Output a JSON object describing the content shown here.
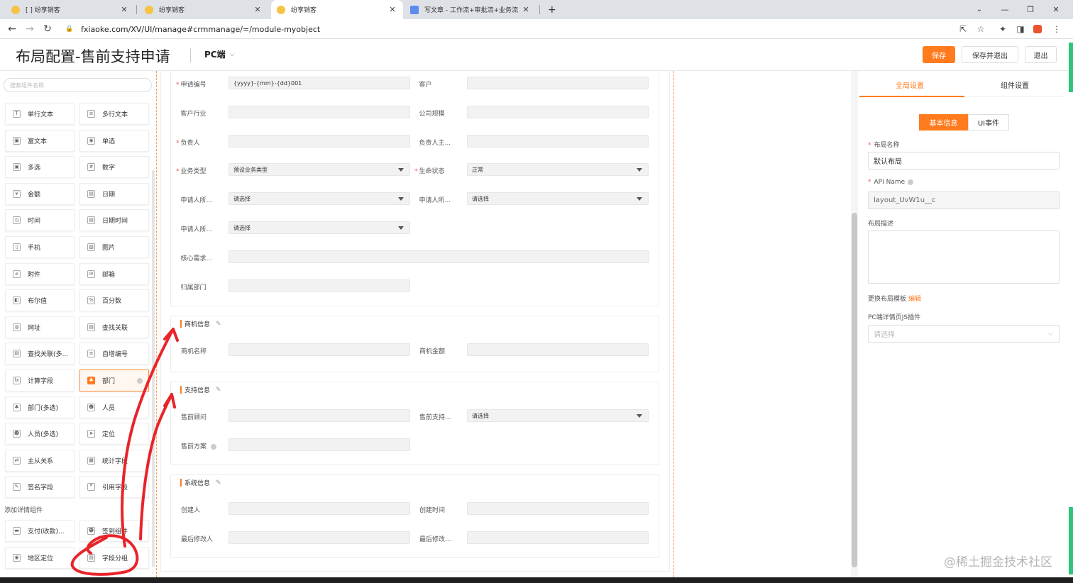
{
  "browser": {
    "tabs": [
      {
        "label": "[        ] 纷享销客",
        "active": false
      },
      {
        "label": "纷享销客",
        "active": false
      },
      {
        "label": "纷享销客",
        "active": true
      },
      {
        "label": "写文章 - 工作流+审批流+业务流",
        "active": false
      }
    ],
    "new_tab": "+",
    "url": "fxiaoke.com/XV/UI/manage#crmmanage/=/module-myobject"
  },
  "header": {
    "title": "布局配置-售前支持申请",
    "platform": "PC端",
    "save_label": "保存",
    "save_exit_label": "保存并退出",
    "exit_label": "退出"
  },
  "palette": {
    "search_placeholder": "搜索组件名称",
    "items": [
      {
        "label": "单行文本",
        "icon": "T"
      },
      {
        "label": "多行文本",
        "icon": "≡"
      },
      {
        "label": "富文本",
        "icon": "▣"
      },
      {
        "label": "单选",
        "icon": "◉"
      },
      {
        "label": "多选",
        "icon": "▣"
      },
      {
        "label": "数字",
        "icon": "#"
      },
      {
        "label": "金额",
        "icon": "¥"
      },
      {
        "label": "日期",
        "icon": "▤"
      },
      {
        "label": "时间",
        "icon": "◷"
      },
      {
        "label": "日期时间",
        "icon": "▤"
      },
      {
        "label": "手机",
        "icon": "▯"
      },
      {
        "label": "图片",
        "icon": "▧"
      },
      {
        "label": "附件",
        "icon": "⌀"
      },
      {
        "label": "邮箱",
        "icon": "✉"
      },
      {
        "label": "布尔值",
        "icon": "◧"
      },
      {
        "label": "百分数",
        "icon": "%"
      },
      {
        "label": "网址",
        "icon": "◍"
      },
      {
        "label": "查找关联",
        "icon": "▤"
      },
      {
        "label": "查找关联(多...",
        "icon": "▤"
      },
      {
        "label": "自增编号",
        "icon": "≡"
      },
      {
        "label": "计算字段",
        "icon": "fx"
      },
      {
        "label": "部门",
        "icon": "♣",
        "highlight": true
      },
      {
        "label": "部门(多选)",
        "icon": "♣"
      },
      {
        "label": "人员",
        "icon": "☻"
      },
      {
        "label": "人员(多选)",
        "icon": "☻"
      },
      {
        "label": "定位",
        "icon": "➤"
      },
      {
        "label": "主从关系",
        "icon": "⇄"
      },
      {
        "label": "统计字段",
        "icon": "▦"
      },
      {
        "label": "签名字段",
        "icon": "✎"
      },
      {
        "label": "引用字段",
        "icon": "❞"
      }
    ],
    "section_label": "添加详情组件",
    "detail_items": [
      {
        "label": "支付(收款)...",
        "icon": "▬"
      },
      {
        "label": "签到组件",
        "icon": "☻"
      },
      {
        "label": "地区定位",
        "icon": "◉"
      },
      {
        "label": "字段分组",
        "icon": "▤"
      }
    ]
  },
  "form": {
    "top_fields": [
      {
        "label": "申请编号",
        "required": true,
        "value": "{yyyy}-{mm}-{dd}001",
        "kind": "text"
      },
      {
        "label": "客户",
        "required": false,
        "value": "",
        "kind": "text"
      },
      {
        "label": "客户行业",
        "required": false,
        "value": "",
        "kind": "text"
      },
      {
        "label": "公司规模",
        "required": false,
        "value": "",
        "kind": "text"
      },
      {
        "label": "负责人",
        "required": true,
        "value": "",
        "kind": "text"
      },
      {
        "label": "负责人主...",
        "required": false,
        "value": "",
        "kind": "text"
      },
      {
        "label": "业务类型",
        "required": true,
        "value": "预设业务类型",
        "kind": "select"
      },
      {
        "label": "生命状态",
        "required": true,
        "value": "正常",
        "kind": "select"
      },
      {
        "label": "申请人所...",
        "required": false,
        "value": "请选择",
        "kind": "select"
      },
      {
        "label": "申请人所...",
        "required": false,
        "value": "请选择",
        "kind": "select"
      },
      {
        "label": "申请人所...",
        "required": false,
        "value": "请选择",
        "kind": "select"
      },
      {
        "label": "核心需求...",
        "required": false,
        "value": "",
        "kind": "wide"
      },
      {
        "label": "归属部门",
        "required": false,
        "value": "",
        "kind": "text"
      }
    ],
    "groups": [
      {
        "title": "商机信息",
        "fields": [
          {
            "label": "商机名称",
            "value": ""
          },
          {
            "label": "商机金额",
            "value": ""
          }
        ]
      },
      {
        "title": "支持信息",
        "fields": [
          {
            "label": "售前顾问",
            "value": ""
          },
          {
            "label": "售前支持...",
            "value": "请选择"
          },
          {
            "label": "售前方案",
            "value": ""
          }
        ]
      },
      {
        "title": "系统信息",
        "fields": [
          {
            "label": "创建人",
            "value": ""
          },
          {
            "label": "创建时间",
            "value": ""
          },
          {
            "label": "最后修改人",
            "value": ""
          },
          {
            "label": "最后修改...",
            "value": ""
          }
        ]
      }
    ]
  },
  "settings": {
    "tabs": [
      "全局设置",
      "组件设置"
    ],
    "segments": [
      "基本信息",
      "UI事件"
    ],
    "layout_name_label": "布局名称",
    "layout_name_value": "默认布局",
    "api_name_label": "API Name",
    "api_name_value": "layout_UvW1u__c",
    "desc_label": "布局描述",
    "template_label": "更换布局模板",
    "template_link": "编辑",
    "plugin_label": "PC端详情页JS插件",
    "plugin_placeholder": "请选择"
  },
  "watermark": "@稀土掘金技术社区",
  "colors": {
    "accent": "#ff7b1e",
    "annotation": "#e8242a"
  }
}
